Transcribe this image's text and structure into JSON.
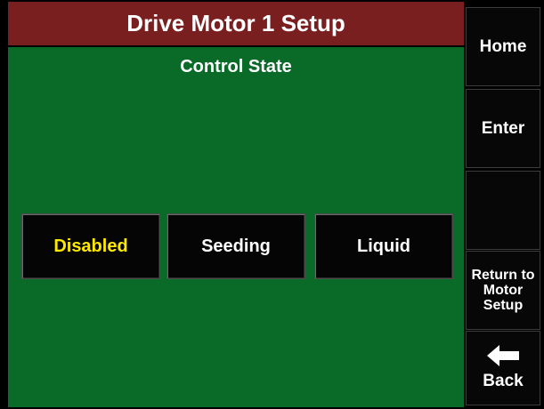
{
  "header": {
    "title": "Drive Motor 1 Setup"
  },
  "main": {
    "section_label": "Control State",
    "options": [
      {
        "label": "Disabled",
        "selected": true
      },
      {
        "label": "Seeding",
        "selected": false
      },
      {
        "label": "Liquid",
        "selected": false
      }
    ],
    "selected_color": "#ffe800"
  },
  "sidebar": {
    "home_label": "Home",
    "enter_label": "Enter",
    "blank_label": "",
    "return_label": "Return to Motor Setup",
    "back_label": "Back",
    "back_icon": "arrow-left-icon"
  },
  "colors": {
    "title_bar": "#7a1f1f",
    "background": "#0a6a28",
    "button": "#050505"
  }
}
